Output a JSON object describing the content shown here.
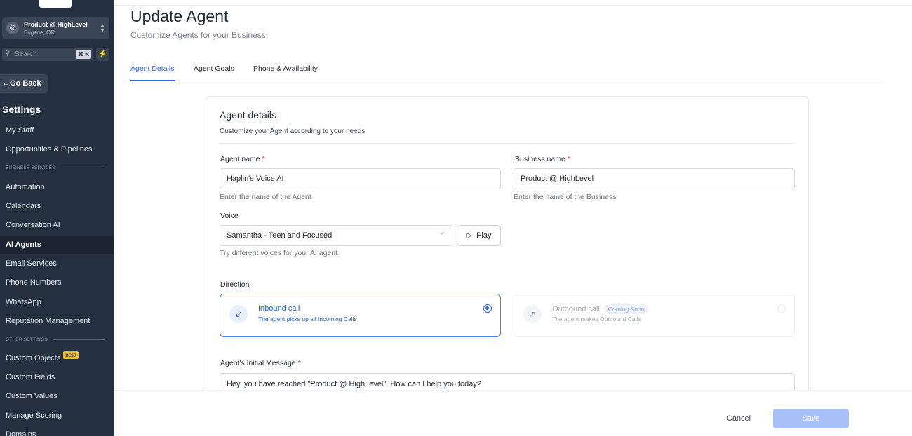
{
  "sidebar": {
    "account": {
      "name": "Product @ HighLevel",
      "location": "Eugene, OR"
    },
    "search": {
      "placeholder": "Search",
      "shortcut": "⌘ K"
    },
    "go_back": "Go Back",
    "title": "Settings",
    "items": [
      {
        "label": "My Staff"
      },
      {
        "label": "Opportunities & Pipelines"
      },
      {
        "label": "Automation"
      },
      {
        "label": "Calendars"
      },
      {
        "label": "Conversation AI"
      },
      {
        "label": "AI Agents",
        "active": true
      },
      {
        "label": "Email Services"
      },
      {
        "label": "Phone Numbers"
      },
      {
        "label": "WhatsApp"
      },
      {
        "label": "Reputation Management"
      },
      {
        "label": "Custom Objects",
        "badge": "beta"
      },
      {
        "label": "Custom Fields"
      },
      {
        "label": "Custom Values"
      },
      {
        "label": "Manage Scoring"
      },
      {
        "label": "Domains"
      }
    ],
    "sections": {
      "business": "BUSINESS SERVICES",
      "other": "OTHER SETTINGS"
    }
  },
  "header": {
    "title": "Update Agent",
    "subtitle": "Customize Agents for your Business"
  },
  "tabs": [
    {
      "label": "Agent Details",
      "active": true
    },
    {
      "label": "Agent Goals"
    },
    {
      "label": "Phone & Availability"
    }
  ],
  "card": {
    "title": "Agent details",
    "subtitle": "Customize your Agent according to your needs",
    "agent_name": {
      "label": "Agent name",
      "value": "Haplin's Voice AI",
      "hint": "Enter the name of the Agent"
    },
    "business_name": {
      "label": "Business name",
      "value": "Product @ HighLevel",
      "hint": "Enter the name of the Business"
    },
    "voice": {
      "label": "Voice",
      "value": "Samantha - Teen and Focused",
      "hint": "Try different voices for your AI agent",
      "play_label": "Play"
    },
    "direction": {
      "label": "Direction",
      "inbound": {
        "title": "Inbound call",
        "desc": "The agent picks up all Incoming Calls",
        "selected": true
      },
      "outbound": {
        "title": "Outbound call",
        "badge": "Coming Soon",
        "desc": "The agent makes Outbound Calls",
        "selected": false
      }
    },
    "initial_message": {
      "label": "Agent's Initial Message",
      "value": "Hey, you have reached \"Product @ HighLevel\". How can I help you today?"
    },
    "required_mark": "*"
  },
  "footer": {
    "cancel_label": "Cancel",
    "save_label": "Save"
  },
  "colors": {
    "sidebar_bg": "#243040",
    "accent": "#2563eb",
    "save_disabled": "#a9c1f7"
  }
}
